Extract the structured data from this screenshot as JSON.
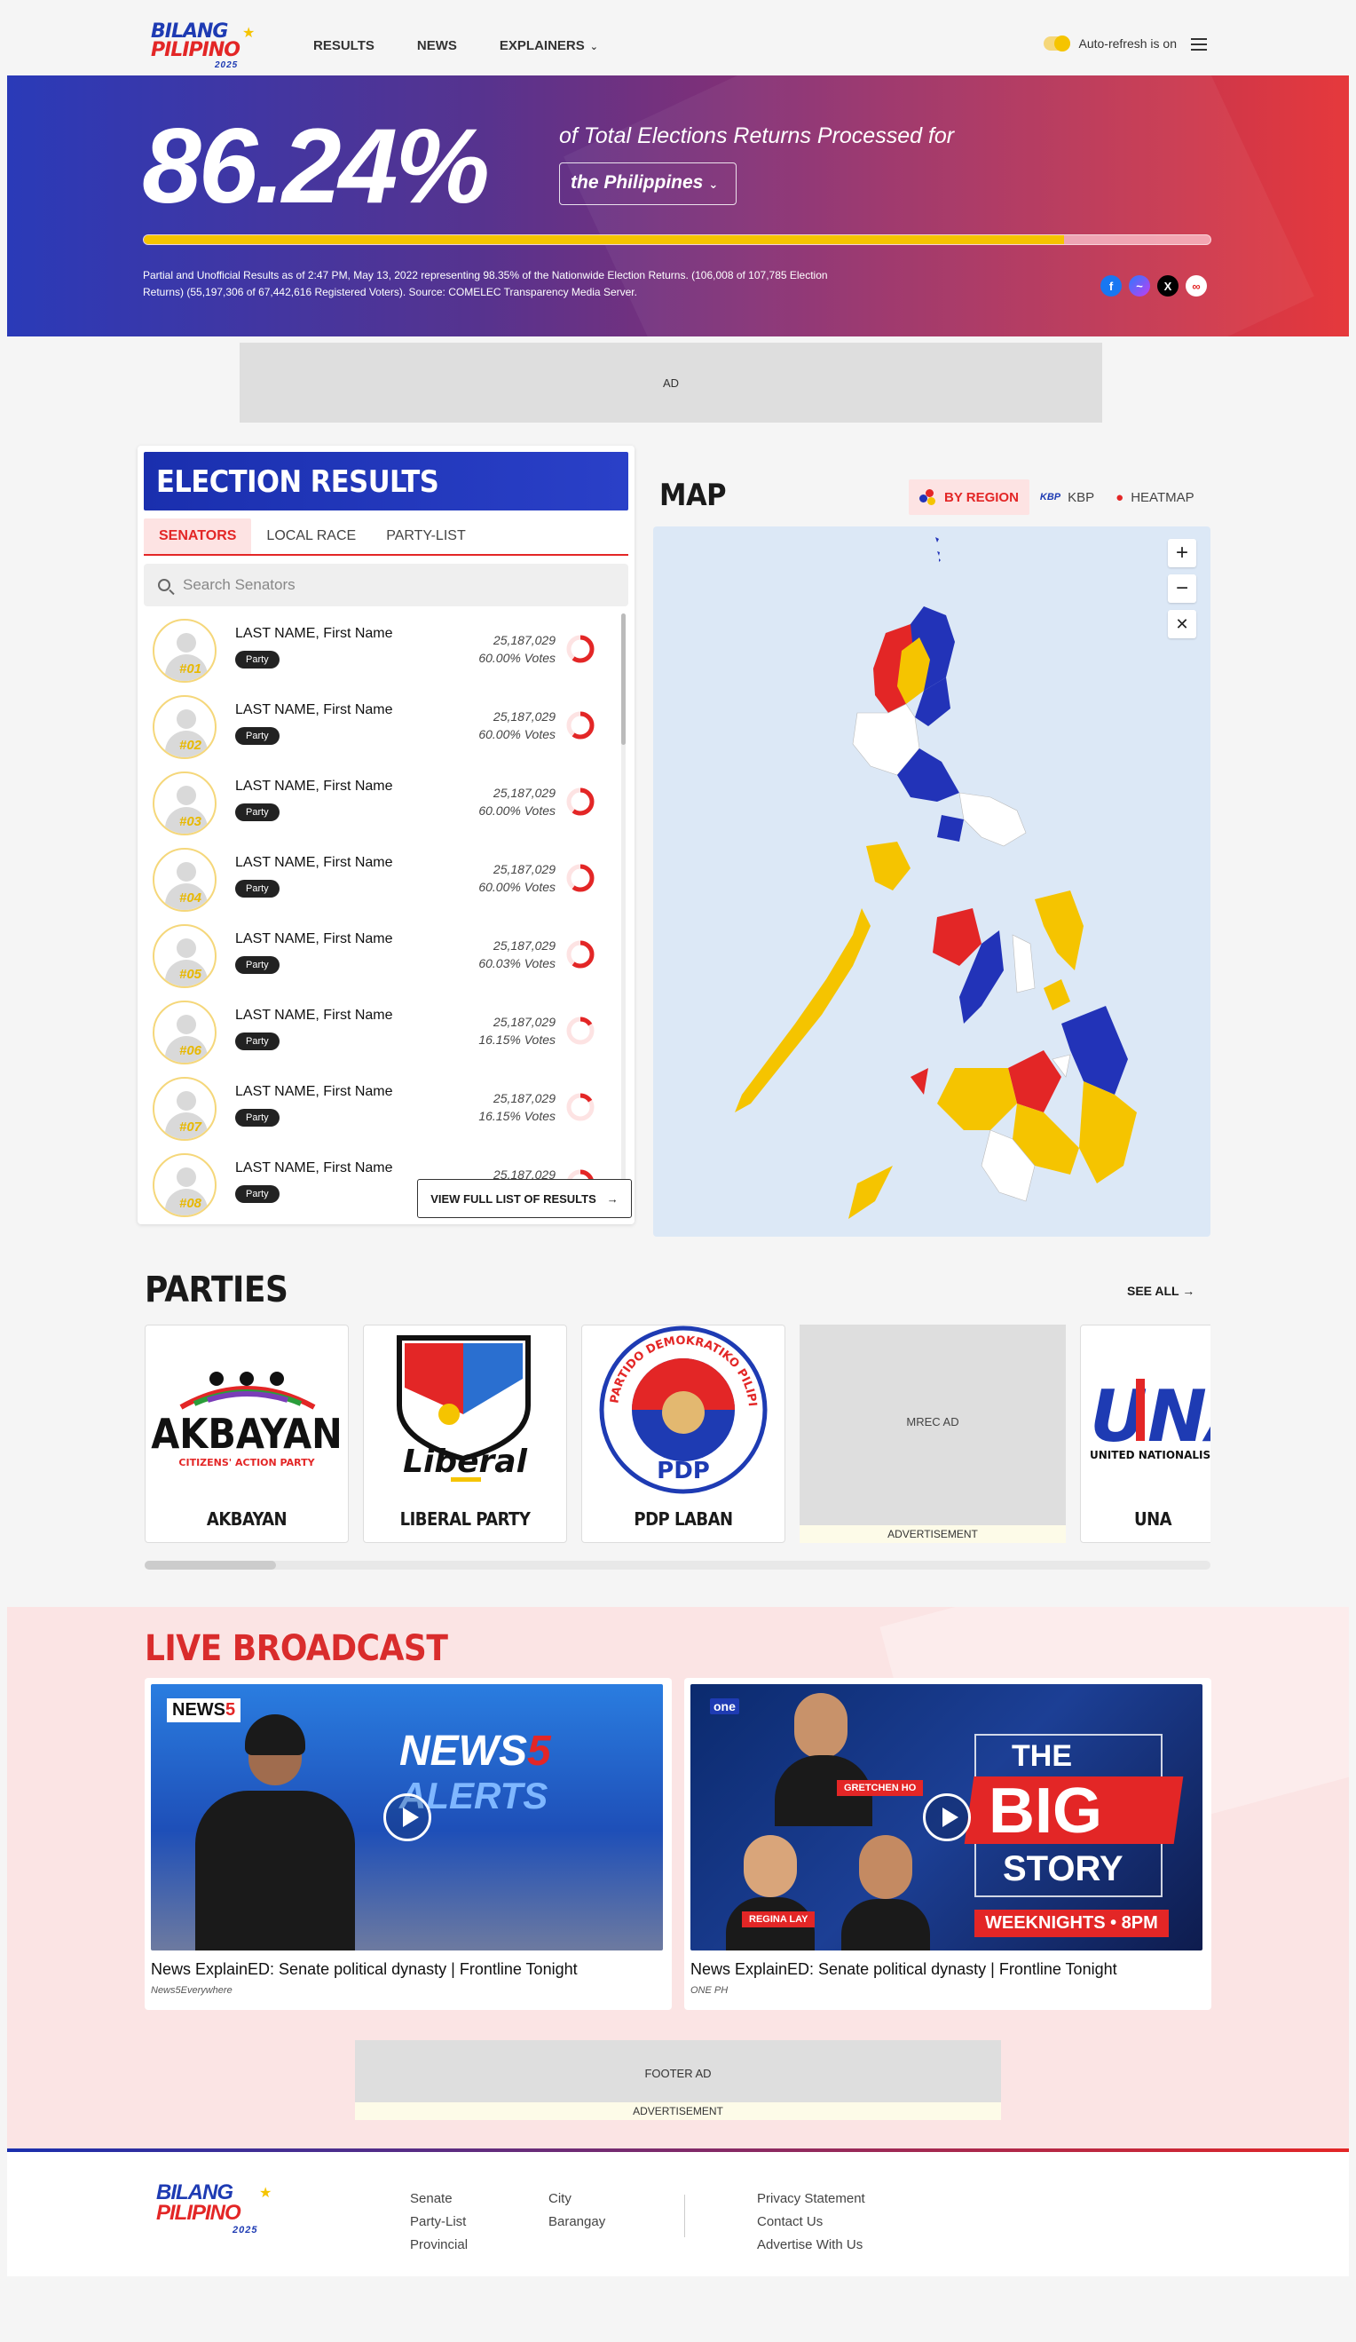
{
  "header": {
    "logo": {
      "line1": "BILANG",
      "line2": "PILIPINO",
      "year": "2025"
    },
    "nav": [
      {
        "label": "RESULTS"
      },
      {
        "label": "NEWS"
      },
      {
        "label": "EXPLAINERS"
      }
    ],
    "auto_refresh_label": "Auto-refresh is on"
  },
  "hero": {
    "percentage": "86.24%",
    "progress_fraction": 0.8624,
    "processed_text": "of Total Elections Returns Processed for",
    "region_selected": "the Philippines",
    "fineprint": "Partial and Unofficial Results as of 2:47 PM, May 13, 2022 representing 98.35% of the Nationwide Election Returns. (106,008 of 107,785 Election Returns) (55,197,306 of 67,442,616 Registered Voters). Source: COMELEC Transparency Media Server."
  },
  "top_ad": "AD",
  "results": {
    "title": "ELECTION RESULTS",
    "tabs": [
      "SENATORS",
      "LOCAL RACE",
      "PARTY-LIST"
    ],
    "search_placeholder": "Search Senators",
    "candidates": [
      {
        "rank": "#01",
        "name": "LAST NAME, First Name",
        "party": "Party",
        "votes": "25,187,029",
        "pct": "60.00% Votes",
        "share": 0.6
      },
      {
        "rank": "#02",
        "name": "LAST NAME, First Name",
        "party": "Party",
        "votes": "25,187,029",
        "pct": "60.00% Votes",
        "share": 0.6
      },
      {
        "rank": "#03",
        "name": "LAST NAME, First Name",
        "party": "Party",
        "votes": "25,187,029",
        "pct": "60.00% Votes",
        "share": 0.6
      },
      {
        "rank": "#04",
        "name": "LAST NAME, First Name",
        "party": "Party",
        "votes": "25,187,029",
        "pct": "60.00% Votes",
        "share": 0.6
      },
      {
        "rank": "#05",
        "name": "LAST NAME, First Name",
        "party": "Party",
        "votes": "25,187,029",
        "pct": "60.03% Votes",
        "share": 0.6003
      },
      {
        "rank": "#06",
        "name": "LAST NAME, First Name",
        "party": "Party",
        "votes": "25,187,029",
        "pct": "16.15% Votes",
        "share": 0.1615
      },
      {
        "rank": "#07",
        "name": "LAST NAME, First Name",
        "party": "Party",
        "votes": "25,187,029",
        "pct": "16.15% Votes",
        "share": 0.1615
      },
      {
        "rank": "#08",
        "name": "LAST NAME, First Name",
        "party": "Party",
        "votes": "25,187,029",
        "pct": "",
        "share": 0.6
      }
    ],
    "view_full_label": "VIEW FULL LIST OF RESULTS"
  },
  "map": {
    "title": "MAP",
    "modes": [
      "BY REGION",
      "KBP",
      "HEATMAP"
    ],
    "kbp_mark": "KBP",
    "colors": {
      "red": "#e32626",
      "blue": "#2233b8",
      "yellow": "#f5c400",
      "white": "#ffffff"
    }
  },
  "parties": {
    "title": "PARTIES",
    "see_all": "SEE ALL",
    "items": [
      {
        "name": "AKBAYAN",
        "logo_word": "AKBAYAN",
        "logo_sub": "CITIZENS' ACTION PARTY"
      },
      {
        "name": "LIBERAL PARTY",
        "logo_word": "Liberal"
      },
      {
        "name": "PDP LABAN",
        "logo_ring": "PARTIDO DEMOKRATIKO PILIPINO",
        "logo_word": "PDP"
      },
      {
        "name": "UNA",
        "logo_word": "UNA",
        "logo_sub": "UNITED NATIONALIST"
      }
    ],
    "mrec_ad": "MREC AD",
    "advertisement": "ADVERTISEMENT"
  },
  "live": {
    "title": "LIVE BROADCAST",
    "videos": [
      {
        "title": "News ExplainED: Senate political dynasty | Frontline Tonight",
        "source": "News5Everywhere",
        "brand": "NEWS",
        "brand_num": "5",
        "overlay": "ALERTS"
      },
      {
        "title": "News ExplainED: Senate political dynasty | Frontline Tonight",
        "source": "ONE PH",
        "brand": "one",
        "show_line1": "THE",
        "show_line2": "BIG",
        "show_line3": "STORY",
        "schedule": "WEEKNIGHTS • 8PM",
        "tag1": "GRETCHEN HO",
        "tag2": "REGINA LAY"
      }
    ],
    "footer_ad": "FOOTER AD",
    "advertisement": "ADVERTISEMENT"
  },
  "footer": {
    "col1": [
      "Senate",
      "Party-List",
      "Provincial"
    ],
    "col2": [
      "City",
      "Barangay"
    ],
    "col3": [
      "Privacy Statement",
      "Contact Us",
      "Advertise With Us"
    ]
  }
}
